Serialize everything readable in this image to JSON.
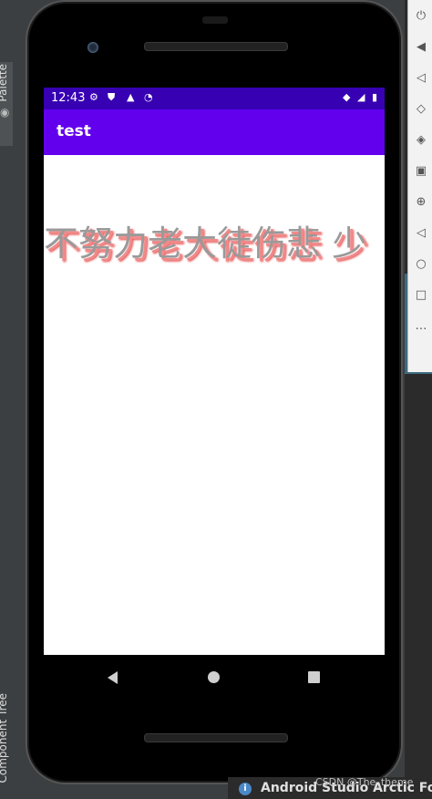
{
  "ide": {
    "left_tab_label": "Palette",
    "left_bottom_label": "Component Tree",
    "bottom_bar_text": "Android Studio Arctic Fox",
    "watermark": "CSDN @The_theme"
  },
  "device": {
    "status_bar": {
      "time": "12:43",
      "left_icons": [
        "gear-icon",
        "shield-icon",
        "a-badge-icon",
        "wifi-question-icon"
      ],
      "right_icons": [
        "wifi-icon",
        "signal-icon",
        "battery-icon"
      ],
      "color": "#3700b3"
    },
    "app_bar": {
      "title": "test",
      "color": "#6200ee"
    },
    "content": {
      "text": "不努力老大徒伤悲 少"
    },
    "nav_bar": [
      "back-icon",
      "home-icon",
      "recents-icon"
    ]
  }
}
